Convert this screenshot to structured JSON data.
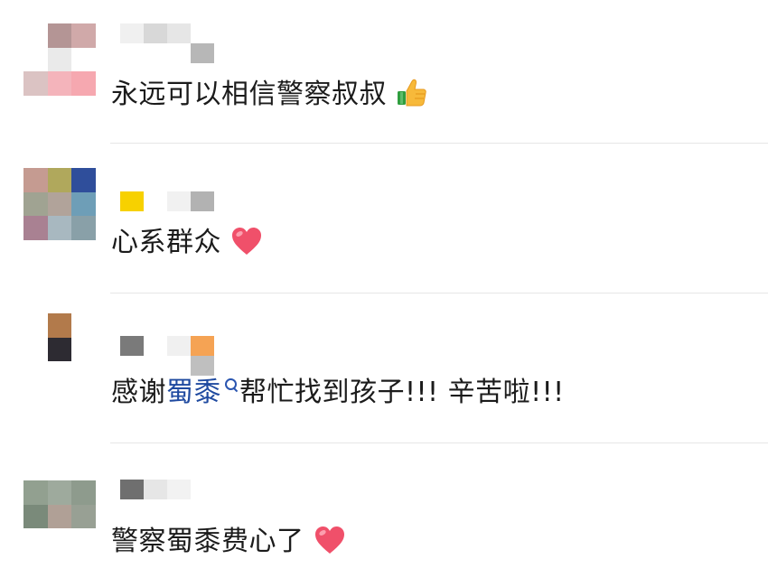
{
  "comments": [
    {
      "text": "永远可以相信警察叔叔",
      "emoji": "thumbs-up-icon",
      "avatar_colors": [
        "#ffffff",
        "#b49595",
        "#d0a9a9",
        "#ffffff",
        "#eaeaea",
        "#ffffff",
        "#dbc3c3",
        "#f4b4bb",
        "#f6a8b0"
      ],
      "nick_colors": [
        "#f0f0f0",
        "#d8d8d8",
        "#e6e6e6",
        "#ffffff",
        "#b7b7b7"
      ]
    },
    {
      "text": "心系群众",
      "emoji": "red-heart-icon",
      "avatar_colors": [
        "#c59b91",
        "#b0a85c",
        "#2f4e9b",
        "#a0a392",
        "#b1a39a",
        "#6e9eb7",
        "#a98192",
        "#a8b8c0",
        "#89a0a8"
      ],
      "nick_colors": [
        "#f7d100",
        "#ffffff",
        "#f1f1f1",
        "#b2b2b2",
        "#ffffff"
      ]
    },
    {
      "text_before": "感谢",
      "link_text": "蜀黍",
      "text_after": "帮忙找到孩子!!! 辛苦啦!!!",
      "avatar_colors": [
        "#ffffff",
        "#b27a4b",
        "#ffffff",
        "#ffffff",
        "#2d2b32",
        "#ffffff",
        "#ffffff",
        "#ffffff",
        "#ffffff"
      ],
      "nick_colors": [
        "#7a7a7a",
        "#ffffff",
        "#f0f0f0",
        "#f5a354",
        "#bfbfbf"
      ]
    },
    {
      "text": "警察蜀黍费心了",
      "emoji": "red-heart-icon",
      "avatar_colors": [
        "#92a090",
        "#9eaa9d",
        "#8e9b8d",
        "#7a8a7a",
        "#b0a096",
        "#98a094",
        "#ffffff",
        "#ffffff",
        "#ffffff"
      ],
      "nick_colors": [
        "#6f6f6f",
        "#e6e6e6",
        "#f2f2f2",
        "#ffffff",
        "#ffffff"
      ]
    }
  ]
}
